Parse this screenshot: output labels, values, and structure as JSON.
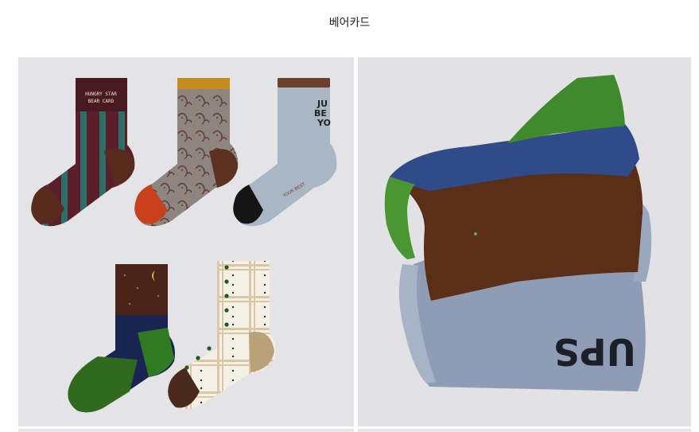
{
  "header": {
    "title": "베어카드"
  },
  "products": [
    {
      "name": "five sock designs illustration",
      "sock_texts": {
        "sock1_line1": "HUNGRY STAR",
        "sock1_line2": "BEAR CARD",
        "sock3_top1": "JU",
        "sock3_top2": "BE",
        "sock3_top3": "YO",
        "sock3_side": "YOUR BEST"
      }
    },
    {
      "name": "folded socks photo"
    }
  ],
  "colors": {
    "page_bg": "#ffffff",
    "tile_bg": "#e4e4e6"
  }
}
